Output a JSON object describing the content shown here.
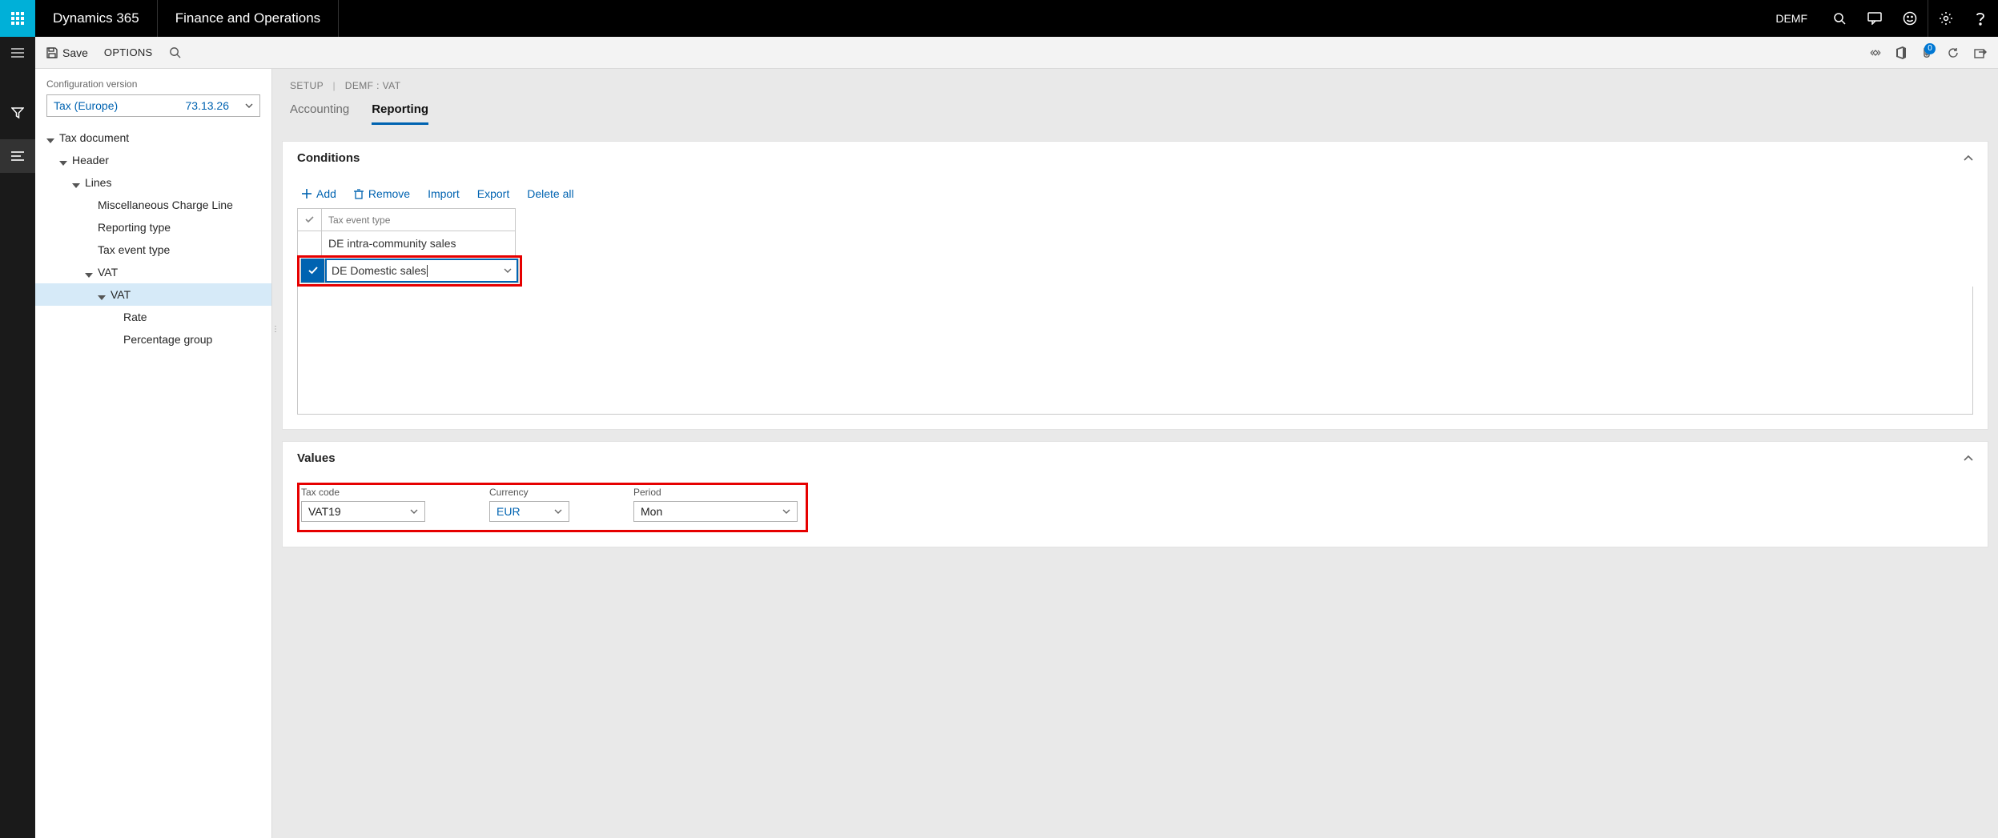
{
  "topbar": {
    "brand": "Dynamics 365",
    "product": "Finance and Operations",
    "company": "DEMF"
  },
  "actionbar": {
    "save_label": "Save",
    "options_label": "OPTIONS",
    "notif_badge": "0"
  },
  "config": {
    "section_label": "Configuration version",
    "dropdown_name": "Tax (Europe)",
    "dropdown_ver": "73.13.26",
    "tree": {
      "n0": "Tax document",
      "n1": "Header",
      "n2": "Lines",
      "n3": "Miscellaneous Charge Line",
      "n4": "Reporting type",
      "n5": "Tax event type",
      "n6": "VAT",
      "n7": "VAT",
      "n8": "Rate",
      "n9": "Percentage group"
    }
  },
  "crumbs": {
    "a": "SETUP",
    "b": "DEMF : VAT"
  },
  "tabs": {
    "accounting": "Accounting",
    "reporting": "Reporting"
  },
  "conditions": {
    "title": "Conditions",
    "toolbar": {
      "add": "Add",
      "remove": "Remove",
      "import": "Import",
      "export": "Export",
      "deleteall": "Delete all"
    },
    "column_header": "Tax event type",
    "rows": [
      {
        "value": "DE intra-community sales",
        "selected": false
      },
      {
        "value": "DE Domestic sales",
        "selected": true
      }
    ]
  },
  "values": {
    "title": "Values",
    "fields": {
      "taxcode": {
        "label": "Tax code",
        "value": "VAT19"
      },
      "currency": {
        "label": "Currency",
        "value": "EUR"
      },
      "period": {
        "label": "Period",
        "value": "Mon"
      }
    }
  }
}
